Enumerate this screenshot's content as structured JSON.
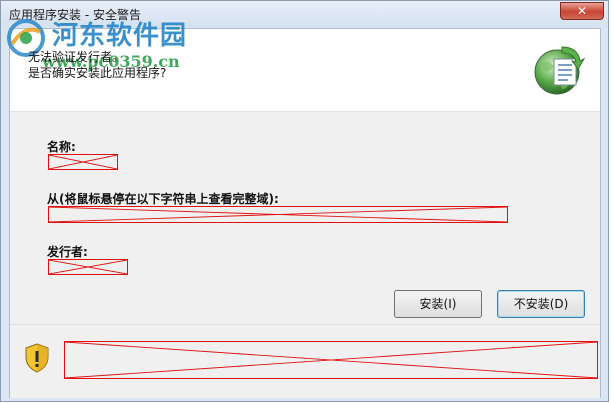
{
  "window": {
    "title": "应用程序安装 - 安全警告",
    "close_glyph": "✕"
  },
  "watermark": {
    "title": "河东软件园",
    "url": "www.pc0359.cn"
  },
  "header": {
    "line1": "无法验证发行者。",
    "line2": "是否确实安装此应用程序?",
    "icon": "application-install-icon"
  },
  "fields": {
    "name_label": "名称:",
    "from_label": "从(将鼠标悬停在以下字符串上查看完整域):",
    "publisher_label": "发行者:"
  },
  "buttons": {
    "install": "安装(I)",
    "dont_install": "不安装(D)"
  },
  "footer": {
    "icon": "warning-shield-icon"
  },
  "colors": {
    "redaction": "#e01010",
    "accent": "#2a87c9"
  }
}
